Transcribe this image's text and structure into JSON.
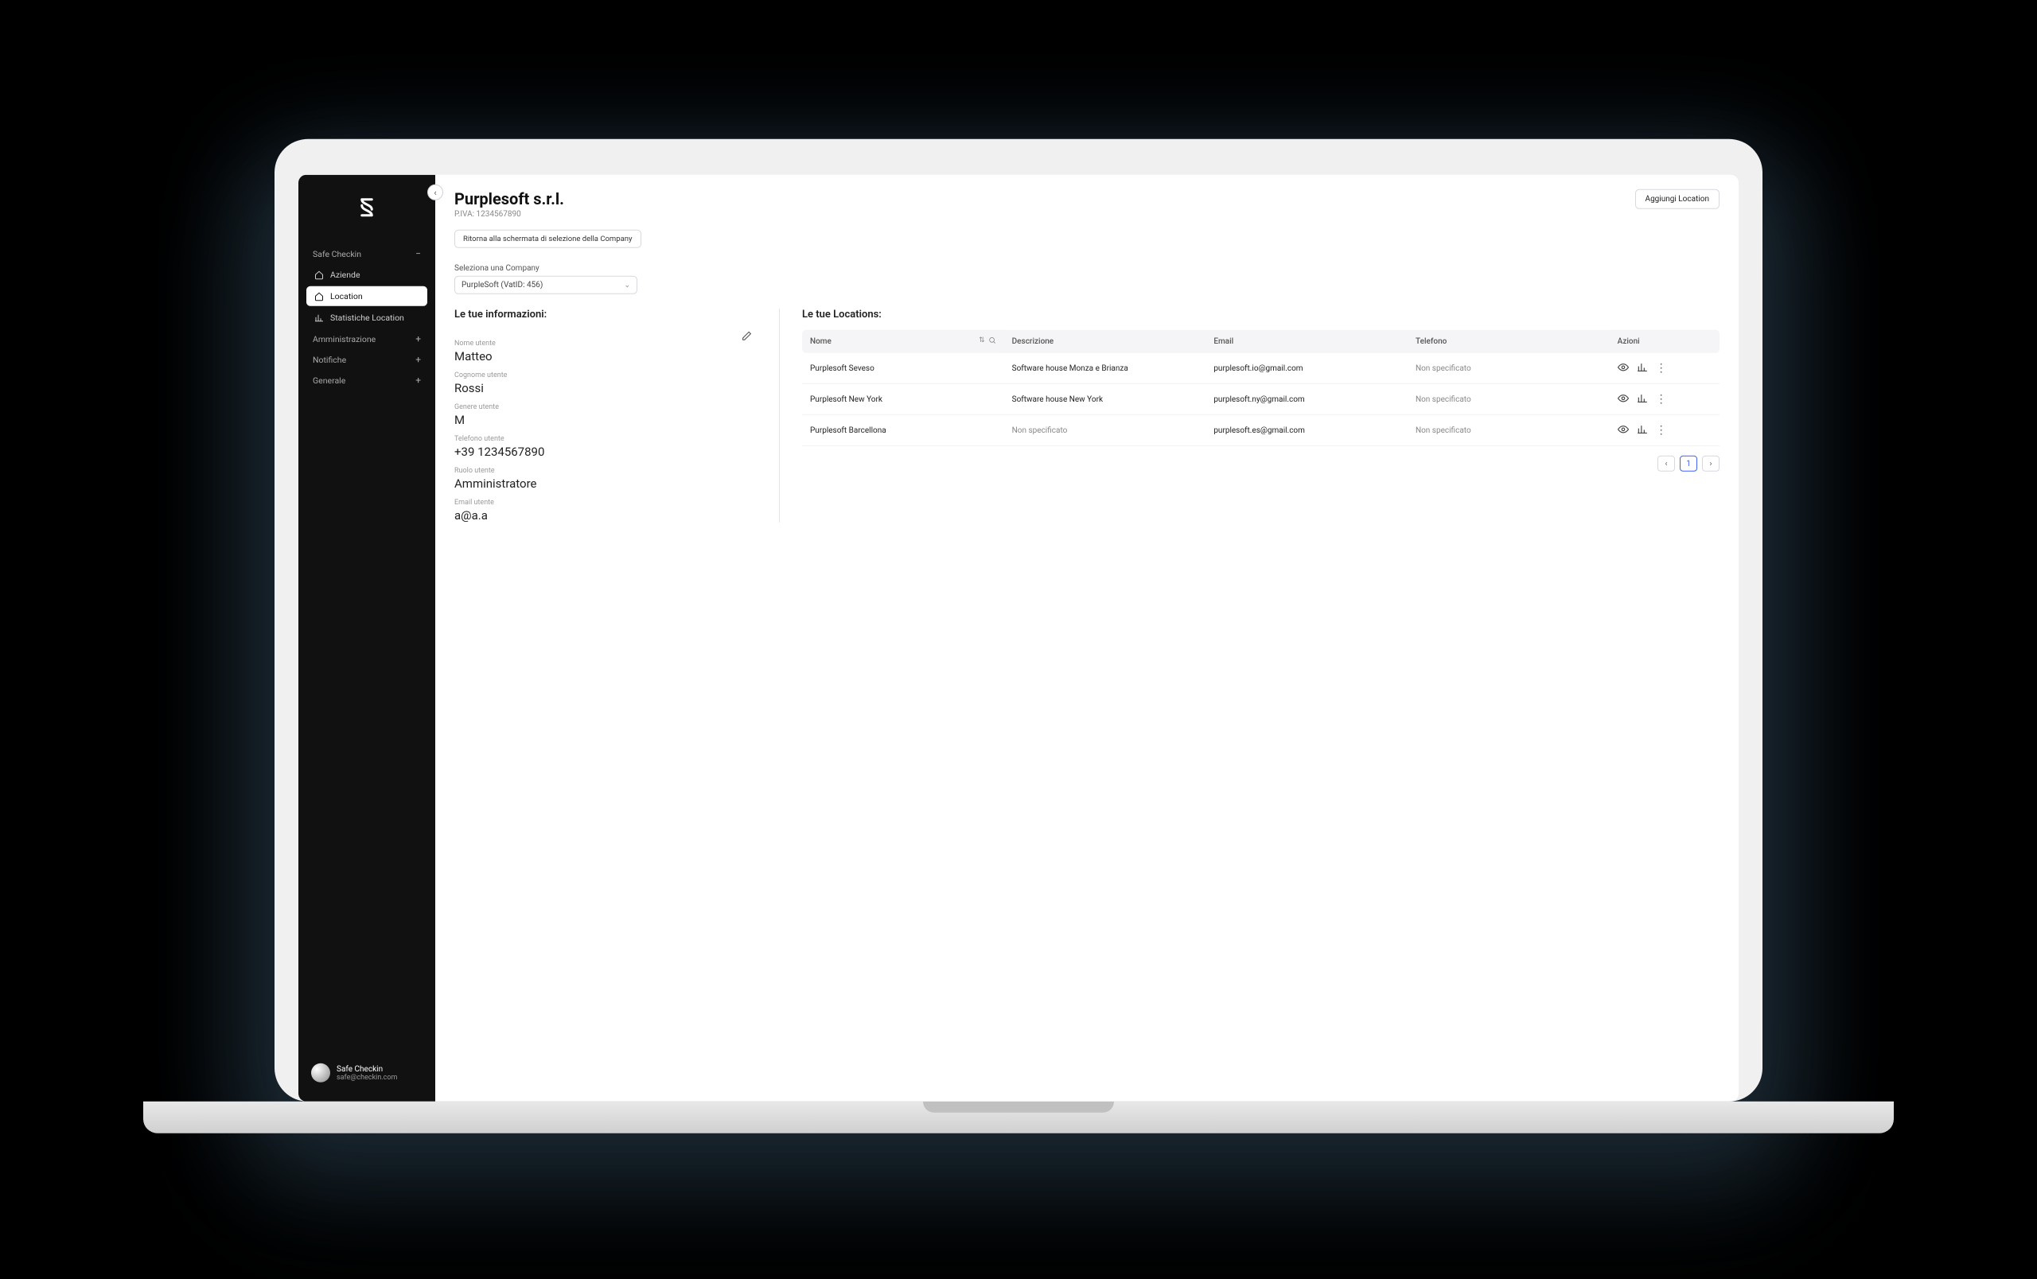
{
  "sidebar": {
    "sections": [
      {
        "label": "Safe Checkin",
        "icon": "minus",
        "items": [
          {
            "label": "Aziende",
            "icon": "home",
            "active": false
          },
          {
            "label": "Location",
            "icon": "home",
            "active": true
          },
          {
            "label": "Statistiche Location",
            "icon": "chart",
            "active": false
          }
        ]
      },
      {
        "label": "Amministrazione",
        "icon": "plus"
      },
      {
        "label": "Notifiche",
        "icon": "plus"
      },
      {
        "label": "Generale",
        "icon": "plus"
      }
    ],
    "footer": {
      "name": "Safe Checkin",
      "email": "safe@checkin.com"
    }
  },
  "header": {
    "company_name": "Purplesoft s.r.l.",
    "vat_line": "P.IVA: 1234567890",
    "back_label": "Ritorna alla schermata di selezione della Company",
    "add_label": "Aggiungi Location"
  },
  "company_select": {
    "label": "Seleziona una Company",
    "value": "PurpleSoft (VatID: 456)"
  },
  "info": {
    "title": "Le tue informazioni:",
    "fields": [
      {
        "label": "Nome utente",
        "value": "Matteo"
      },
      {
        "label": "Cognome utente",
        "value": "Rossi"
      },
      {
        "label": "Genere utente",
        "value": "M"
      },
      {
        "label": "Telefono utente",
        "value": "+39 1234567890"
      },
      {
        "label": "Ruolo utente",
        "value": "Amministratore"
      },
      {
        "label": "Email utente",
        "value": "a@a.a"
      }
    ]
  },
  "locations": {
    "title": "Le tue Locations:",
    "columns": {
      "nome": "Nome",
      "descrizione": "Descrizione",
      "email": "Email",
      "telefono": "Telefono",
      "azioni": "Azioni"
    },
    "rows": [
      {
        "nome": "Purplesoft Seveso",
        "descrizione": "Software house Monza e Brianza",
        "email": "purplesoft.io@gmail.com",
        "telefono": "Non specificato"
      },
      {
        "nome": "Purplesoft New York",
        "descrizione": "Software house New York",
        "email": "purplesoft.ny@gmail.com",
        "telefono": "Non specificato"
      },
      {
        "nome": "Purplesoft Barcellona",
        "descrizione": "Non specificato",
        "email": "purplesoft.es@gmail.com",
        "telefono": "Non specificato"
      }
    ],
    "pagination": {
      "page": "1"
    }
  }
}
